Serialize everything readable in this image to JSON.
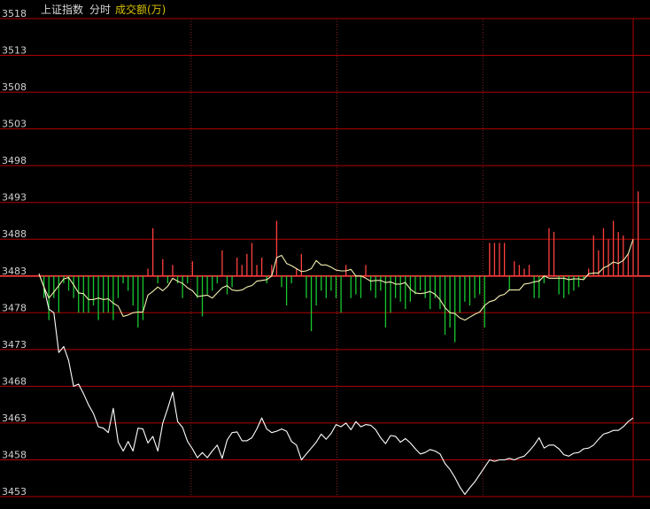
{
  "header": {
    "index_name": "上证指数",
    "mode": "分时",
    "metric": "成交额(万)"
  },
  "colors": {
    "background": "#000000",
    "grid": "#b00000",
    "axis_label": "#d0d0d0",
    "vertical_grid": "#8a2020",
    "baseline": "#ff3a3a",
    "price_line": "#ffffff",
    "average_line": "#f4f0b0",
    "up_bar": "#ff4040",
    "down_bar": "#18c830"
  },
  "chart_data": {
    "type": "line",
    "title": "上证指数",
    "ylim": [
      3453,
      3518
    ],
    "y_ticks": [
      "3518",
      "3513",
      "3508",
      "3503",
      "3498",
      "3493",
      "3488",
      "3483",
      "3478",
      "3473",
      "3468",
      "3463",
      "3458",
      "3453"
    ],
    "baseline": 3483,
    "x_points": 121,
    "series": [
      {
        "name": "price",
        "values": [
          3483.3,
          3481.5,
          3478.5,
          3478.0,
          3472.6,
          3473.4,
          3471.5,
          3468.0,
          3468.3,
          3467.0,
          3465.5,
          3464.3,
          3462.5,
          3462.3,
          3461.7,
          3465.0,
          3460.4,
          3459.2,
          3460.5,
          3459.2,
          3462.3,
          3462.2,
          3460.3,
          3461.2,
          3459.2,
          3463.0,
          3465.0,
          3467.2,
          3463.2,
          3462.4,
          3460.5,
          3459.5,
          3458.3,
          3459.0,
          3458.3,
          3459.2,
          3460.0,
          3458.2,
          3460.7,
          3461.7,
          3461.8,
          3460.6,
          3460.6,
          3461.0,
          3462.2,
          3463.7,
          3462.2,
          3461.7,
          3461.9,
          3462.2,
          3461.9,
          3460.5,
          3460.0,
          3458.0,
          3458.8,
          3459.6,
          3460.4,
          3461.5,
          3460.8,
          3461.6,
          3462.8,
          3462.5,
          3463.0,
          3462.1,
          3463.2,
          3462.5,
          3462.8,
          3462.7,
          3462.1,
          3461.0,
          3460.2,
          3461.3,
          3461.2,
          3460.4,
          3460.9,
          3460.3,
          3459.5,
          3458.8,
          3459.0,
          3459.4,
          3459.2,
          3458.8,
          3457.5,
          3456.7,
          3455.6,
          3454.3,
          3453.3,
          3454.2,
          3455.0,
          3456.0,
          3457.0,
          3458.0,
          3457.8,
          3458.0,
          3458.0,
          3458.2,
          3458.0,
          3458.3,
          3458.5,
          3459.2,
          3460.0,
          3461.0,
          3459.6,
          3460.0,
          3460.0,
          3459.5,
          3458.7,
          3458.5,
          3458.9,
          3459.0,
          3459.5,
          3459.6,
          3460.0,
          3460.8,
          3461.5,
          3461.7,
          3462.0,
          3462.0,
          3462.5,
          3463.2,
          3463.7
        ]
      },
      {
        "name": "average",
        "values": [
          3483.3,
          3481.5,
          3480.0,
          3480.8,
          3481.7,
          3482.6,
          3482.8,
          3481.8,
          3480.7,
          3480.6,
          3479.8,
          3479.8,
          3480.0,
          3479.8,
          3479.9,
          3479.3,
          3478.9,
          3477.5,
          3477.7,
          3478.0,
          3478.1,
          3478.1,
          3480.4,
          3480.9,
          3481.5,
          3481.0,
          3481.6,
          3482.7,
          3482.3,
          3482.0,
          3481.4,
          3481.0,
          3480.2,
          3480.3,
          3480.4,
          3480.0,
          3480.7,
          3481.4,
          3481.7,
          3481.1,
          3481.0,
          3481.1,
          3481.5,
          3481.7,
          3482.3,
          3482.4,
          3482.5,
          3483.0,
          3485.5,
          3485.8,
          3484.7,
          3484.4,
          3484.0,
          3483.6,
          3483.7,
          3484.0,
          3485.1,
          3484.5,
          3484.5,
          3484.2,
          3483.8,
          3483.7,
          3483.7,
          3483.9,
          3483.0,
          3483.0,
          3482.7,
          3482.3,
          3482.4,
          3482.4,
          3482.1,
          3482.2,
          3481.9,
          3481.9,
          3482.1,
          3481.2,
          3480.7,
          3480.6,
          3480.7,
          3480.9,
          3480.5,
          3479.8,
          3478.7,
          3478.0,
          3477.9,
          3477.3,
          3477.0,
          3477.4,
          3477.8,
          3478.1,
          3479.0,
          3479.5,
          3479.7,
          3480.3,
          3480.5,
          3481.1,
          3481.1,
          3481.1,
          3481.9,
          3482.0,
          3482.2,
          3482.3,
          3483.0,
          3482.7,
          3482.7,
          3482.7,
          3482.7,
          3482.5,
          3482.6,
          3482.6,
          3482.5,
          3483.3,
          3483.4,
          3483.4,
          3484.1,
          3484.4,
          3484.9,
          3484.7,
          3485.1,
          3486.0,
          3488.0
        ]
      }
    ],
    "bar_values": [
      0,
      -3.0,
      -6.0,
      -3.0,
      -5.0,
      -1.0,
      -2.0,
      -3.0,
      -5.0,
      -5.0,
      -5.0,
      -4.0,
      -6.0,
      -5.0,
      -5.0,
      -6.0,
      -3.0,
      -1.0,
      -2.0,
      -4.0,
      -7.0,
      -6.0,
      1.0,
      6.5,
      -1.0,
      2.3,
      -1.0,
      1.5,
      -1.0,
      -3.0,
      -1.0,
      2.0,
      -3.0,
      -5.5,
      -2.5,
      -2.0,
      -1.0,
      3.5,
      -2.5,
      -1.5,
      2.5,
      1.5,
      3.0,
      4.5,
      1.5,
      2.5,
      -1.0,
      1.5,
      7.5,
      -1.5,
      -4.0,
      -1.0,
      1.0,
      3.0,
      -3.0,
      -7.5,
      -4.0,
      -2.0,
      -3.0,
      -2.0,
      -3.0,
      -5.0,
      1.5,
      -3.0,
      -2.5,
      -3.0,
      1.5,
      -2.0,
      -3.0,
      -2.0,
      -7.0,
      -5.0,
      -3.0,
      -3.5,
      -4.5,
      -3.5,
      -2.5,
      -2.0,
      -3.0,
      -4.5,
      -3.0,
      -4.5,
      -8.0,
      -7.0,
      -9.0,
      -5.0,
      -3.5,
      -4.0,
      -3.0,
      -2.5,
      -7.0,
      4.5,
      4.5,
      4.5,
      4.5,
      -2.0,
      2.0,
      1.5,
      1.0,
      1.5,
      -3.0,
      -3.0,
      -1.0,
      6.5,
      6.0,
      -2.5,
      -3.0,
      -2.5,
      -2.0,
      -1.5,
      -0.5,
      1.0,
      5.5,
      3.5,
      6.5,
      5.0,
      7.5,
      6.0,
      5.5,
      3.0,
      5.0,
      11.5
    ]
  }
}
